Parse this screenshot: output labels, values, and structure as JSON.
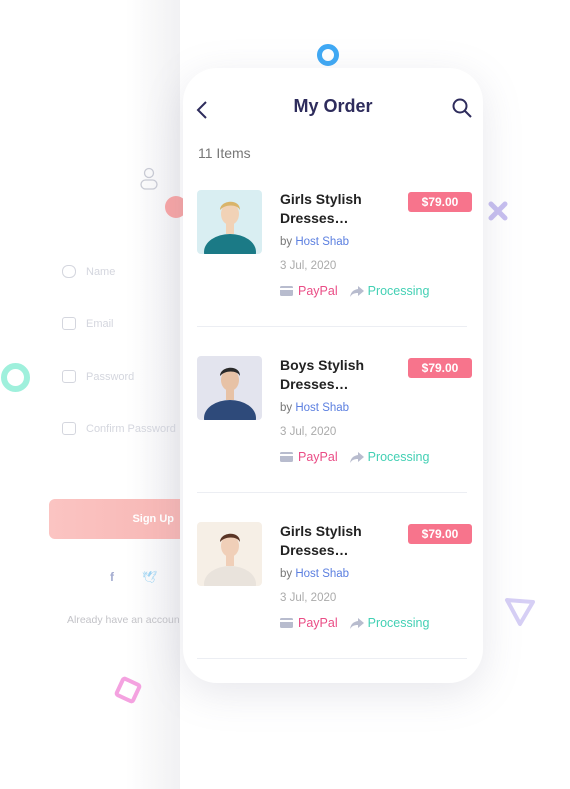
{
  "background_form": {
    "fields": [
      {
        "label": "Name",
        "icon": "user-icon"
      },
      {
        "label": "Email",
        "icon": "mail-icon"
      },
      {
        "label": "Password",
        "icon": "lock-icon"
      },
      {
        "label": "Confirm Password",
        "icon": "lock-icon"
      }
    ],
    "signup_label": "Sign Up",
    "footer_text": "Already have an account",
    "social": [
      "facebook-icon",
      "twitter-icon"
    ]
  },
  "header": {
    "title": "My Order",
    "back_icon": "chevron-left-icon",
    "search_icon": "search-icon"
  },
  "items_count": "11 Items",
  "orders": [
    {
      "name": "Girls Stylish Dresses…",
      "price": "$79.00",
      "by": "by",
      "seller": "Host Shab",
      "date": "3 Jul, 2020",
      "payment": "PayPal",
      "status": "Processing"
    },
    {
      "name": "Boys Stylish Dresses…",
      "price": "$79.00",
      "by": "by",
      "seller": "Host Shab",
      "date": "3 Jul, 2020",
      "payment": "PayPal",
      "status": "Processing"
    },
    {
      "name": "Girls Stylish Dresses…",
      "price": "$79.00",
      "by": "by",
      "seller": "Host Shab",
      "date": "3 Jul, 2020",
      "payment": "PayPal",
      "status": "Processing"
    }
  ],
  "colors": {
    "title": "#2e2c5c",
    "price": "#f7748c",
    "seller": "#5b7fe0",
    "payment": "#ea4d86",
    "status": "#43d0b4"
  }
}
